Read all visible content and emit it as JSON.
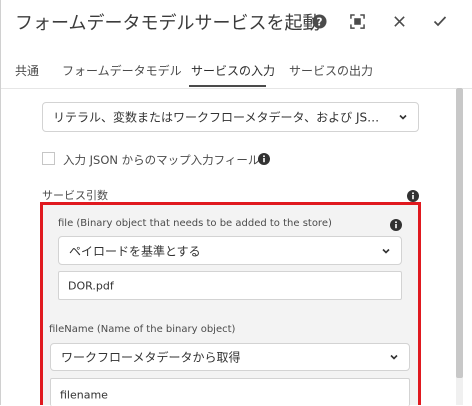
{
  "header": {
    "title": "フォームデータモデルサービスを起動",
    "icons": [
      "help-icon",
      "fullscreen-icon",
      "close-icon",
      "check-icon"
    ]
  },
  "tabs": [
    {
      "label": "共通",
      "active": false
    },
    {
      "label": "フォームデータモデル",
      "active": false
    },
    {
      "label": "サービスの入力",
      "active": true
    },
    {
      "label": "サービスの出力",
      "active": false
    }
  ],
  "input_mode": {
    "selected": "リテラル、変数またはワークフローメタデータ、および JSON ファイル..."
  },
  "map_checkbox": {
    "label": "入力 JSON からのマップ入力フィールド",
    "checked": false
  },
  "service_args": {
    "heading": "サービス引数",
    "args": [
      {
        "label": "file (Binary object that needs to be added to the store)",
        "source": "ペイロードを基準とする",
        "value": "DOR.pdf"
      },
      {
        "label": "fileName (Name of the binary object)",
        "source": "ワークフローメタデータから取得",
        "value": "filename"
      }
    ]
  },
  "colors": {
    "highlight": "#e0191f",
    "panel_bg": "#f3f3f3"
  }
}
